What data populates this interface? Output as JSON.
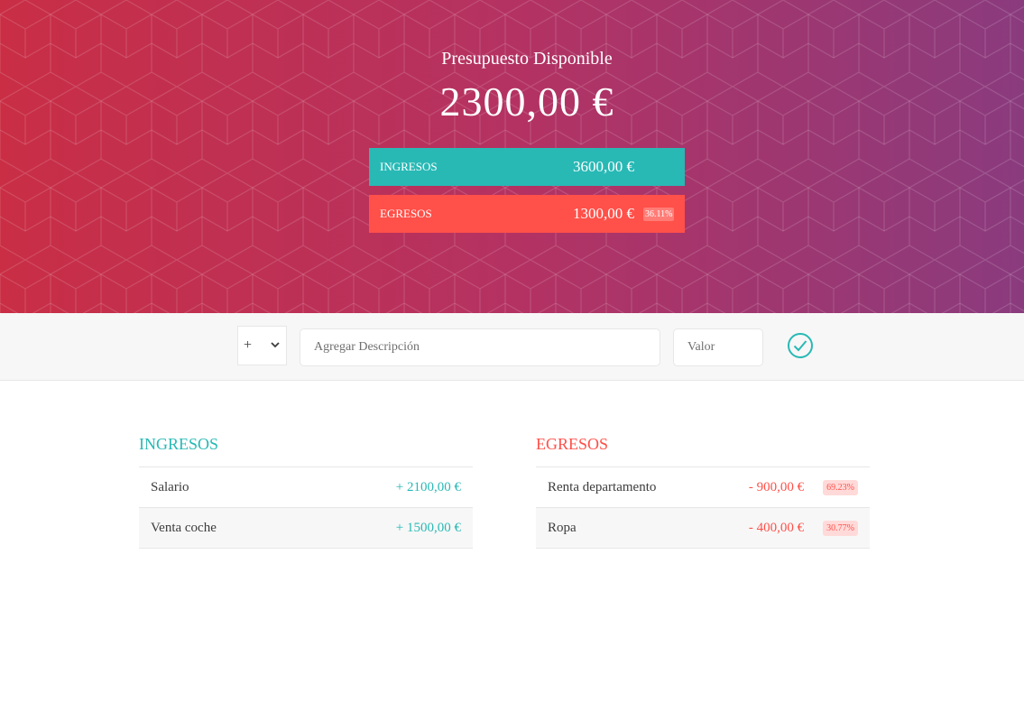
{
  "header": {
    "title": "Presupuesto Disponible",
    "budget": "2300,00 €",
    "income": {
      "label": "Ingresos",
      "value": "3600,00 €",
      "percentage": ""
    },
    "expenses": {
      "label": "Egresos",
      "value": "1300,00 €",
      "percentage": "36.11%"
    },
    "colors": {
      "gradient_start": "#c92e45",
      "gradient_end": "#8a3b7e",
      "income": "#28b9b5",
      "expense": "#ff5049"
    }
  },
  "add_bar": {
    "type_value": "+",
    "description_placeholder": "Agregar Descripción",
    "value_placeholder": "Valor",
    "submit_icon": "check-circle-icon"
  },
  "income_list": {
    "title": "Ingresos",
    "items": [
      {
        "description": "Salario",
        "value": "+ 2100,00 €"
      },
      {
        "description": "Venta coche",
        "value": "+ 1500,00 €"
      }
    ]
  },
  "expense_list": {
    "title": "Egresos",
    "items": [
      {
        "description": "Renta departamento",
        "value": "- 900,00 €",
        "percentage": "69.23%"
      },
      {
        "description": "Ropa",
        "value": "- 400,00 €",
        "percentage": "30.77%"
      }
    ]
  }
}
